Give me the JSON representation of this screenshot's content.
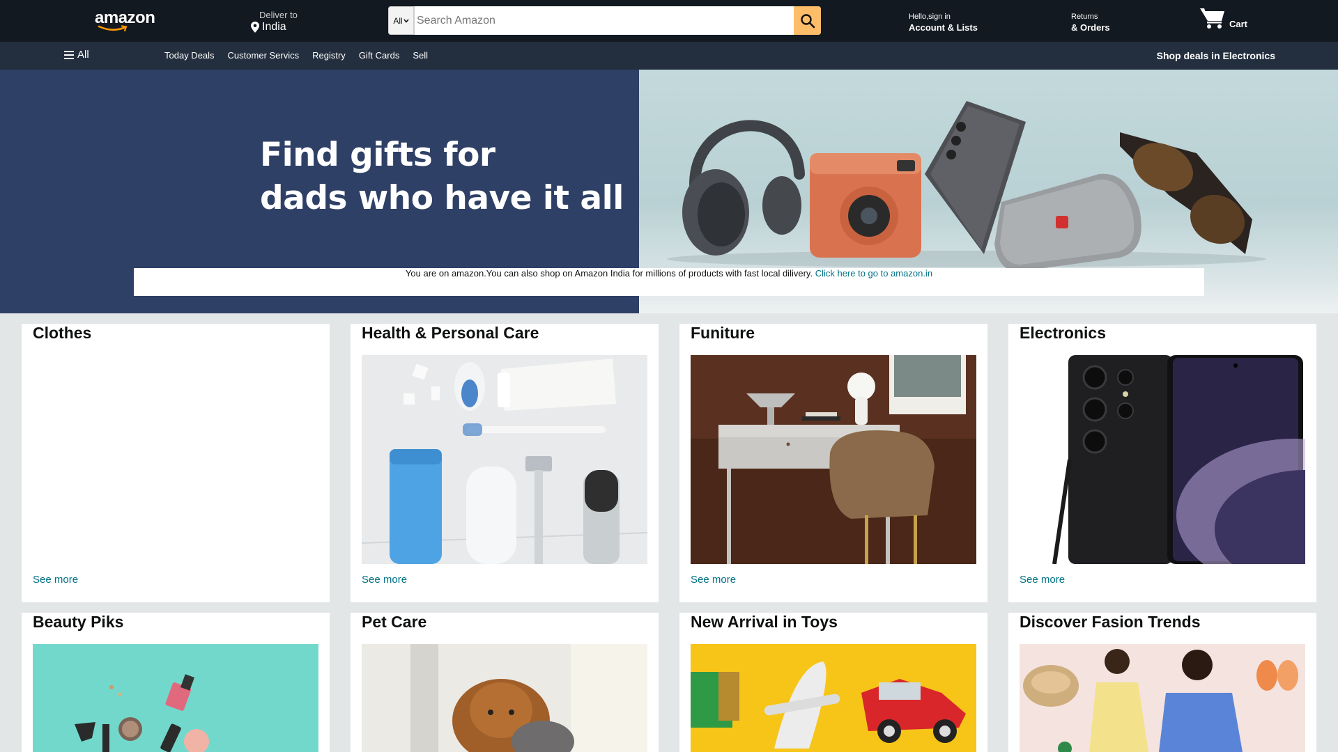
{
  "nav": {
    "logo": "amazon",
    "deliver_to_label": "Deliver to",
    "deliver_to_location": "India",
    "search_category": "All",
    "search_placeholder": "Search Amazon",
    "account_line1": "Hello,sign in",
    "account_line2": "Account & Lists",
    "returns_line1": "Returns",
    "returns_line2": "& Orders",
    "cart_label": "Cart",
    "accent_color": "#febd69",
    "bar_color": "#131921"
  },
  "subnav": {
    "all_label": "All",
    "links": [
      "Today Deals",
      "Customer Servics",
      "Registry",
      "Gift Cards",
      "Sell"
    ],
    "promo": "Shop deals in Electronics"
  },
  "hero": {
    "title_line1": "Find gifts for",
    "title_line2": "dads who have it all",
    "notice_text": "You are on amazon.You can also shop on Amazon India for millions of products with fast local dilivery.",
    "notice_link": "Click here to go to amazon.in"
  },
  "cards": [
    {
      "title": "Clothes",
      "see_more": "See more"
    },
    {
      "title": "Health & Personal Care",
      "see_more": "See more"
    },
    {
      "title": "Funiture",
      "see_more": "See more"
    },
    {
      "title": "Electronics",
      "see_more": "See more"
    },
    {
      "title": "Beauty Piks"
    },
    {
      "title": "Pet Care"
    },
    {
      "title": "New Arrival in Toys"
    },
    {
      "title": "Discover Fasion Trends"
    }
  ]
}
